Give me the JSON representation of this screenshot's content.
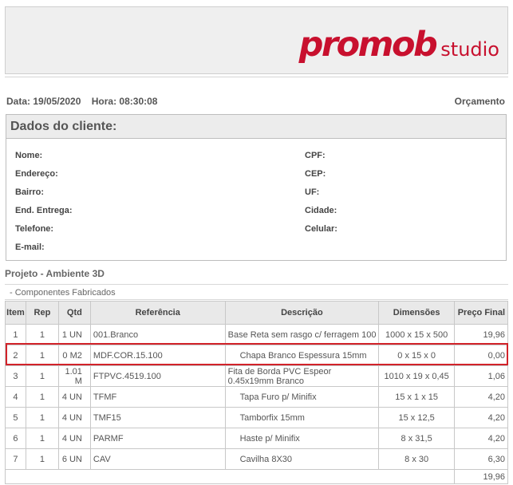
{
  "logo": {
    "brand": "promob",
    "product": "studio",
    "color": "#c8102e"
  },
  "header": {
    "date_label": "Data: 19/05/2020",
    "time_label": "Hora: 08:30:08",
    "doc_type": "Orçamento"
  },
  "client": {
    "title": "Dados do cliente:",
    "fields_left": [
      "Nome:",
      "Endereço:",
      "Bairro:",
      "End. Entrega:",
      "Telefone:",
      "E-mail:"
    ],
    "fields_right": [
      "CPF:",
      "CEP:",
      "UF:",
      "Cidade:",
      "Celular:"
    ]
  },
  "project": {
    "title": "Projeto - Ambiente 3D",
    "section": "- Componentes Fabricados"
  },
  "table": {
    "headers": [
      "Item",
      "Rep",
      "Qtd",
      "Referência",
      "Descrição",
      "Dimensões",
      "Preço Final"
    ],
    "rows": [
      {
        "item": "1",
        "rep": "1",
        "qtd": "1 UN",
        "ref": "001.Branco",
        "desc": "Base Reta sem rasgo c/ ferragem 100",
        "dim": "1000 x 15 x 500",
        "price": "19,96"
      },
      {
        "item": "2",
        "rep": "1",
        "qtd": "0 M2",
        "ref": "MDF.COR.15.100",
        "desc": "Chapa Branco Espessura 15mm",
        "dim": "0 x 15 x 0",
        "price": "0,00"
      },
      {
        "item": "3",
        "rep": "1",
        "qtd": "1.01 M",
        "ref": "FTPVC.4519.100",
        "desc": "Fita de Borda PVC Espeor 0.45x19mm Branco",
        "dim": "1010 x 19 x 0,45",
        "price": "1,06"
      },
      {
        "item": "4",
        "rep": "1",
        "qtd": "4 UN",
        "ref": "TFMF",
        "desc": "Tapa Furo p/ Minifix",
        "dim": "15 x 1 x 15",
        "price": "4,20"
      },
      {
        "item": "5",
        "rep": "1",
        "qtd": "4 UN",
        "ref": "TMF15",
        "desc": "Tamborfix 15mm",
        "dim": "15 x 12,5",
        "price": "4,20"
      },
      {
        "item": "6",
        "rep": "1",
        "qtd": "4 UN",
        "ref": "PARMF",
        "desc": "Haste p/ Minifix",
        "dim": "8 x 31,5",
        "price": "4,20"
      },
      {
        "item": "7",
        "rep": "1",
        "qtd": "6 UN",
        "ref": "CAV",
        "desc": "Cavilha 8X30",
        "dim": "8 x 30",
        "price": "6,30"
      }
    ],
    "total": "19,96"
  },
  "highlight_color": "#d2232a"
}
